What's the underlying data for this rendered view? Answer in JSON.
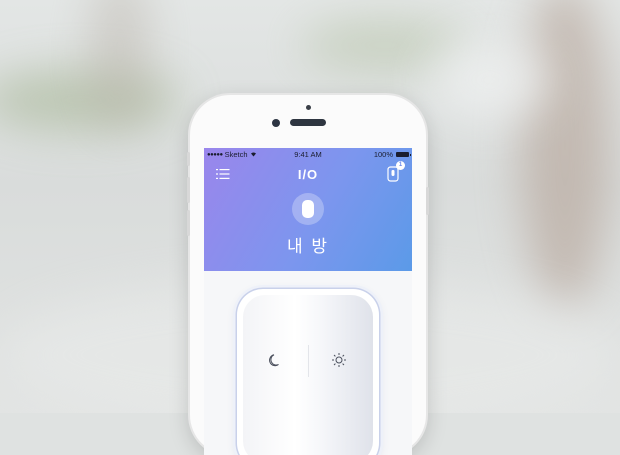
{
  "status_bar": {
    "carrier": "Sketch",
    "time": "9:41 AM",
    "battery": "100%"
  },
  "header": {
    "logo": "I/O",
    "room_name": "내 방",
    "notification_count": "1"
  },
  "colors": {
    "header_gradient_start": "#9a86ec",
    "header_gradient_end": "#5b9ae8",
    "accent": "#6a8aea"
  },
  "icons": {
    "menu": "list-menu-icon",
    "device": "device-icon",
    "room": "light-switch-icon",
    "night": "moon-icon",
    "day": "sun-icon"
  }
}
